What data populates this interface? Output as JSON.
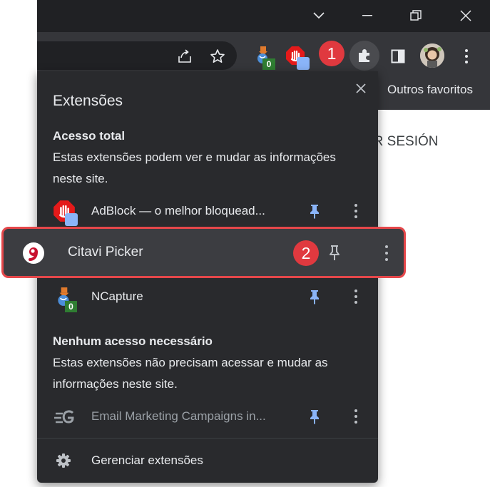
{
  "browser": {
    "bookmarks_label": "Outros favoritos",
    "page_partial_text": "CIAR SESIÓN",
    "ncapture_badge": "0"
  },
  "colors": {
    "accent_pin": "#8ab4f8",
    "callout_red": "#e0393f",
    "highlight_border": "#e5474a"
  },
  "popup": {
    "title": "Extensões",
    "full_access": {
      "heading": "Acesso total",
      "description": "Estas extensões podem ver e mudar as informações neste site.",
      "items": [
        {
          "name": "AdBlock — o melhor bloquead...",
          "icon": "adblock-icon",
          "pinned": true
        },
        {
          "name": "Citavi Picker",
          "icon": "citavi-icon",
          "pinned": false
        },
        {
          "name": "NCapture",
          "icon": "ncapture-icon",
          "pinned": true,
          "badge": "0"
        }
      ]
    },
    "no_access": {
      "heading": "Nenhum acesso necessário",
      "description": "Estas extensões não precisam acessar e mudar as informações neste site.",
      "items": [
        {
          "name": "Email Marketing Campaigns in...",
          "icon": "email-marketing-icon",
          "pinned": true
        }
      ]
    },
    "manage_label": "Gerenciar extensões"
  },
  "callouts": [
    "1",
    "2"
  ]
}
